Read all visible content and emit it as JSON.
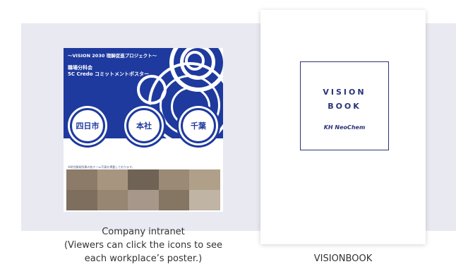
{
  "poster": {
    "header_line1": "～VISION 2030 理解促進プロジェクト～",
    "header_line2": "職場分科会",
    "header_line3": "5C Credo コミットメントポスター",
    "workplaces": [
      "四日市",
      "本社",
      "千葉"
    ],
    "photo_caption": "※研究開発所属の各チーム写真を掲載しております。"
  },
  "book": {
    "title_line1": "VISION",
    "title_line2": "BOOK",
    "logo_text": "KH NeoChem"
  },
  "captions": {
    "intranet_line1": "Company intranet",
    "intranet_line2": "(Viewers can click the icons to see",
    "intranet_line3": "each workplace’s poster.)",
    "visionbook": "VISIONBOOK"
  },
  "colors": {
    "brand_blue": "#1e3a9e",
    "book_navy": "#2a3478",
    "band": "#e8e9f1"
  }
}
